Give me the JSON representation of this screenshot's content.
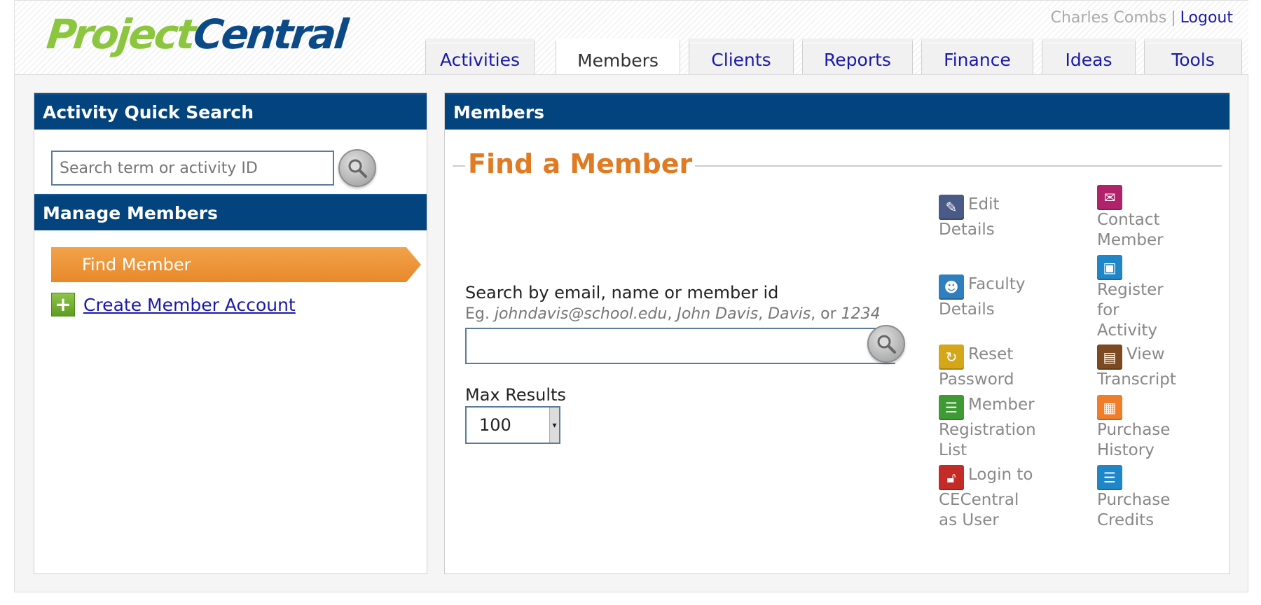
{
  "app": {
    "logo_part1": "Project",
    "logo_part2": "Central"
  },
  "user": {
    "name": "Charles Combs",
    "separator": "|",
    "logout": "Logout"
  },
  "tabs": [
    {
      "label": "Activities",
      "active": false
    },
    {
      "label": "Members",
      "active": true
    },
    {
      "label": "Clients",
      "active": false
    },
    {
      "label": "Reports",
      "active": false
    },
    {
      "label": "Finance",
      "active": false
    },
    {
      "label": "Ideas",
      "active": false
    },
    {
      "label": "Tools",
      "active": false
    }
  ],
  "sidebar": {
    "quick_search_title": "Activity Quick Search",
    "quick_search_placeholder": "Search term or activity ID",
    "manage_title": "Manage Members",
    "find_member": "Find Member",
    "create_account": "Create Member Account"
  },
  "main": {
    "panel_title": "Members",
    "section_title": "Find a Member",
    "search_label": "Search by email, name or member id",
    "hint_prefix": "Eg. ",
    "hint_email": "johndavis@school.edu",
    "hint_sep1": ", ",
    "hint_name": "John Davis",
    "hint_sep2": ", ",
    "hint_last": "Davis",
    "hint_or": ", or ",
    "hint_id": "1234",
    "search_value": "",
    "max_results_label": "Max Results",
    "max_results_value": "100"
  },
  "actions_left": [
    {
      "line1": "Edit",
      "line2": "Details",
      "line3": "",
      "icon": "edit-icon",
      "color": "#4a5a86"
    },
    {
      "line1": "Faculty",
      "line2": "Details",
      "line3": "",
      "icon": "faculty-icon",
      "color": "#2f7fbf"
    },
    {
      "line1": "Reset",
      "line2": "Password",
      "line3": "",
      "icon": "reset-icon",
      "color": "#d4a61a"
    },
    {
      "line1": "Member",
      "line2": "Registration",
      "line3": "List",
      "icon": "list-icon",
      "color": "#3e9b34"
    },
    {
      "line1": "Login to",
      "line2": "CECentral",
      "line3": "as User",
      "icon": "unlock-icon",
      "color": "#c52b26"
    }
  ],
  "actions_right": [
    {
      "line1": "",
      "line2": "Contact",
      "line3": "Member",
      "icon": "mail-icon",
      "color": "#b0236b"
    },
    {
      "line1": "",
      "line2": "Register",
      "line3": "for",
      "line4": "Activity",
      "icon": "clipboard-icon",
      "color": "#1f86c8"
    },
    {
      "line1": "View",
      "line2": "Transcript",
      "line3": "",
      "icon": "document-icon",
      "color": "#7b4a22"
    },
    {
      "line1": "",
      "line2": "Purchase",
      "line3": "History",
      "icon": "cart-icon",
      "color": "#f07d2a"
    },
    {
      "line1": "",
      "line2": "Purchase",
      "line3": "Credits",
      "icon": "credits-list-icon",
      "color": "#1f86c8"
    }
  ]
}
